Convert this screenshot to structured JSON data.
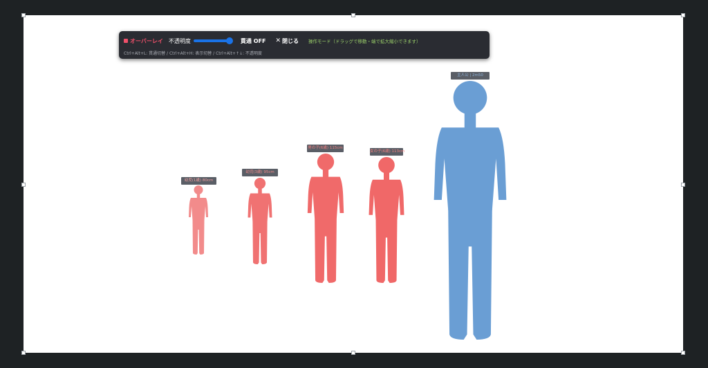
{
  "toolbar": {
    "title": "オーバーレイ",
    "opacity_label": "不透明度",
    "opacity_value": 1.0,
    "passthrough_button": "貫通 OFF",
    "close_button": "閉じる",
    "mode_text": "操作モード（ドラッグで移動・端で拡大縮小できます）",
    "shortcuts": "Ctrl+Alt+L: 貫通切替 / Ctrl+Alt+H: 表示切替 / Ctrl+Alt+↑↓: 不透明度"
  },
  "figures": [
    {
      "label": "幼児(1歳) 80cm",
      "color": "#f28b8b",
      "label_color": "#f0a0a0"
    },
    {
      "label": "幼児(3歳) 95cm",
      "color": "#f07272",
      "label_color": "#f28b8b"
    },
    {
      "label": "男の子(6歳) 115cm",
      "color": "#f06a6a",
      "label_color": "#f28080"
    },
    {
      "label": "女の子(6歳) 113cm",
      "color": "#f06868",
      "label_color": "#f28080"
    },
    {
      "label": "主人公 | 2m50",
      "color": "#6a9ed4",
      "label_color": "#8fb3d9"
    }
  ],
  "colors": {
    "background": "#1e2224",
    "canvas": "#ffffff",
    "accent": "#f0506a",
    "slider": "#1a73e8",
    "mode_text": "#9bd06a"
  }
}
